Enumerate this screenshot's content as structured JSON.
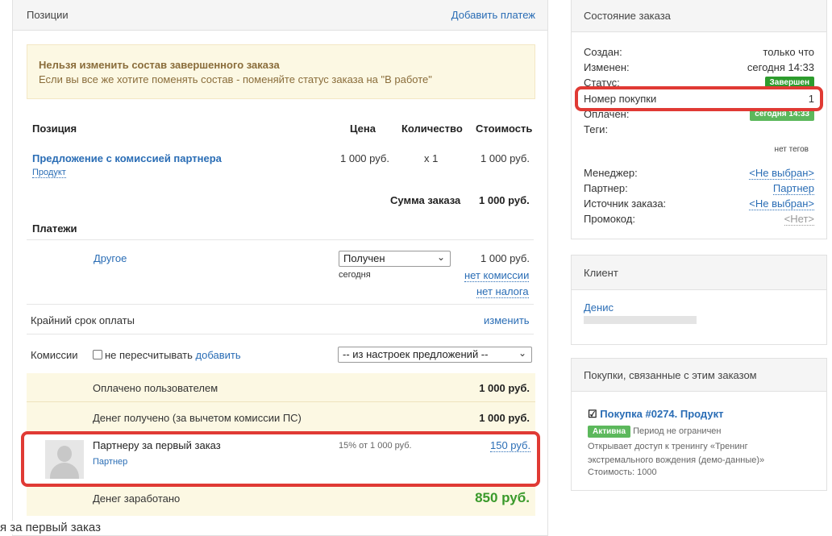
{
  "positions_panel": {
    "title": "Позиции",
    "add_payment": "Добавить платеж",
    "warning": {
      "title": "Нельзя изменить состав завершенного заказа",
      "text": "Если вы все же хотите поменять состав - поменяйте статус заказа на \"В работе\""
    },
    "table_headers": {
      "position": "Позиция",
      "price": "Цена",
      "quantity": "Количество",
      "cost": "Стоимость"
    },
    "item": {
      "name": "Предложение с комиссией партнера",
      "type": "Продукт",
      "price": "1 000 руб.",
      "quantity": "x 1",
      "cost": "1 000 руб."
    },
    "order_sum": {
      "label": "Сумма заказа",
      "value": "1 000 руб."
    },
    "payments": {
      "title": "Платежи",
      "method": "Другое",
      "status": "Получен",
      "date": "сегодня",
      "amount": "1 000 руб.",
      "no_commission": "нет комиссии",
      "no_tax": "нет налога"
    },
    "deadline": {
      "label": "Крайний срок оплаты",
      "action": "изменить"
    },
    "commissions": {
      "label": "Комиссии",
      "checkbox_label": "не пересчитывать",
      "add": "добавить",
      "select": "-- из настроек предложений --"
    },
    "paid_by_user": {
      "label": "Оплачено пользователем",
      "value": "1 000 руб."
    },
    "money_received": {
      "label": "Денег получено (за вычетом комиссии ПС)",
      "value": "1 000 руб."
    },
    "partner_row": {
      "label": "Партнеру за первый заказ",
      "sub": "Партнер",
      "formula": "15% от 1 000 руб.",
      "value": "150 руб."
    },
    "earned": {
      "label": "Денег заработано",
      "value": "850 руб."
    }
  },
  "order_state": {
    "title": "Состояние заказа",
    "rows": {
      "created": {
        "k": "Создан:",
        "v": "только что"
      },
      "changed": {
        "k": "Изменен:",
        "v": "сегодня 14:33"
      },
      "status": {
        "k": "Статус:",
        "v": "Завершен"
      },
      "purchase_no": {
        "k": "Номер покупки",
        "v": "1"
      },
      "paid": {
        "k": "Оплачен:",
        "v": "сегодня 14:33"
      },
      "tags": {
        "k": "Теги:",
        "v": "нет тегов"
      },
      "manager": {
        "k": "Менеджер:",
        "v": "<Не выбран>"
      },
      "partner": {
        "k": "Партнер:",
        "v": "Партнер"
      },
      "source": {
        "k": "Источник заказа:",
        "v": "<Не выбран>"
      },
      "promo": {
        "k": "Промокод:",
        "v": "<Нет>"
      }
    }
  },
  "client": {
    "title": "Клиент",
    "name": "Денис"
  },
  "related": {
    "title": "Покупки, связанные с этим заказом",
    "purchase_link": "Покупка #0274. Продукт",
    "badge": "Активна",
    "period": "Период не ограничен",
    "description": "Открывает доступ к тренингу «Тренинг экстремального вождения (демо-данные)»",
    "cost": "Стоимость: 1000"
  },
  "overlay_text": "я за первый заказ",
  "colors": {
    "accent": "#2a6db5",
    "highlight": "#e03a34",
    "status_green": "#2d9c2d",
    "earned_green": "#3a9a2b"
  }
}
